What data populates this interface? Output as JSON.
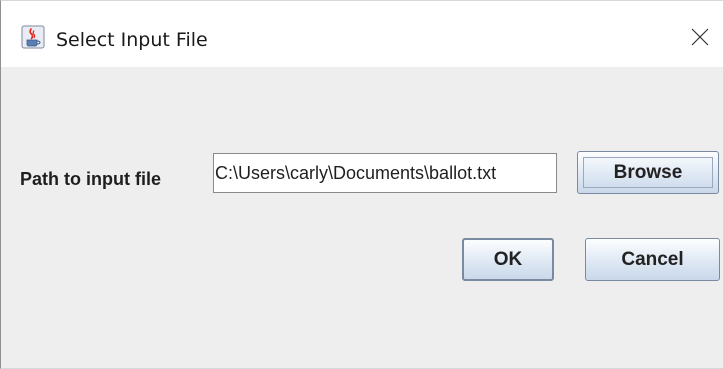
{
  "window": {
    "title": "Select Input File",
    "app_icon": "java-coffee-icon",
    "close_icon": "close-icon"
  },
  "form": {
    "path_label": "Path to input file",
    "path_value": "C:\\Users\\carly\\Documents\\ballot.txt"
  },
  "buttons": {
    "browse_label": "Browse",
    "ok_label": "OK",
    "cancel_label": "Cancel"
  }
}
